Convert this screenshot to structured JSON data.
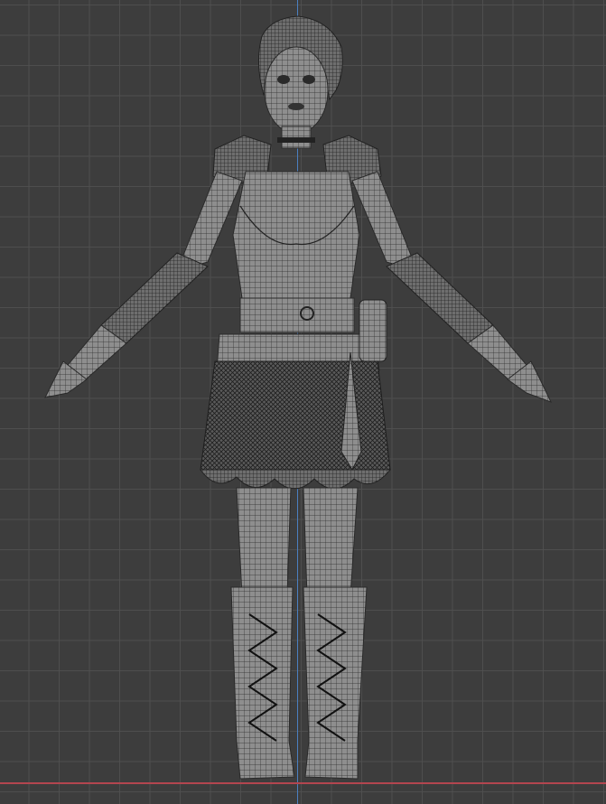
{
  "viewport": {
    "background_color": "#3d3d3d",
    "grid_color": "#505050",
    "axis_y_color": "#4a7fc0",
    "axis_x_color": "#b3454f",
    "mesh_fill": "#8e8e8e",
    "mesh_wire": "#2a2a2a",
    "model_icon": "character-wireframe-mesh"
  }
}
